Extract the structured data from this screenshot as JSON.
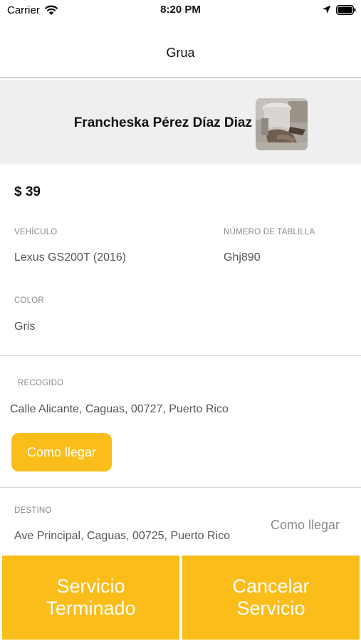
{
  "status_bar": {
    "carrier": "Carrier",
    "time": "8:20 PM"
  },
  "nav": {
    "title": "Grua"
  },
  "profile": {
    "name": "Francheska Pérez Díaz Diaz"
  },
  "trip": {
    "price": "$ 39",
    "vehicle_label": "VEHÍCULO",
    "vehicle_value": "Lexus GS200T (2016)",
    "plate_label": "NÚMERO DE TABLILLA",
    "plate_value": "Ghj890",
    "color_label": "COLOR",
    "color_value": "Gris"
  },
  "pickup": {
    "label": "RECOGIDO",
    "address": "Calle Alicante, Caguas, 00727, Puerto Rico",
    "directions_label": "Como llegar"
  },
  "destination": {
    "label": "DESTINO",
    "address": "Ave Principal, Caguas, 00725, Puerto Rico",
    "directions_label": "Como llegar"
  },
  "actions": {
    "finish_label": "Servicio\nTerminado",
    "cancel_label": "Cancelar\nServicio"
  },
  "colors": {
    "accent": "#fbbd1a",
    "header_bg": "#efefef"
  },
  "icons": {
    "wifi": "wifi-icon",
    "location": "location-arrow-icon",
    "battery": "battery-icon"
  }
}
